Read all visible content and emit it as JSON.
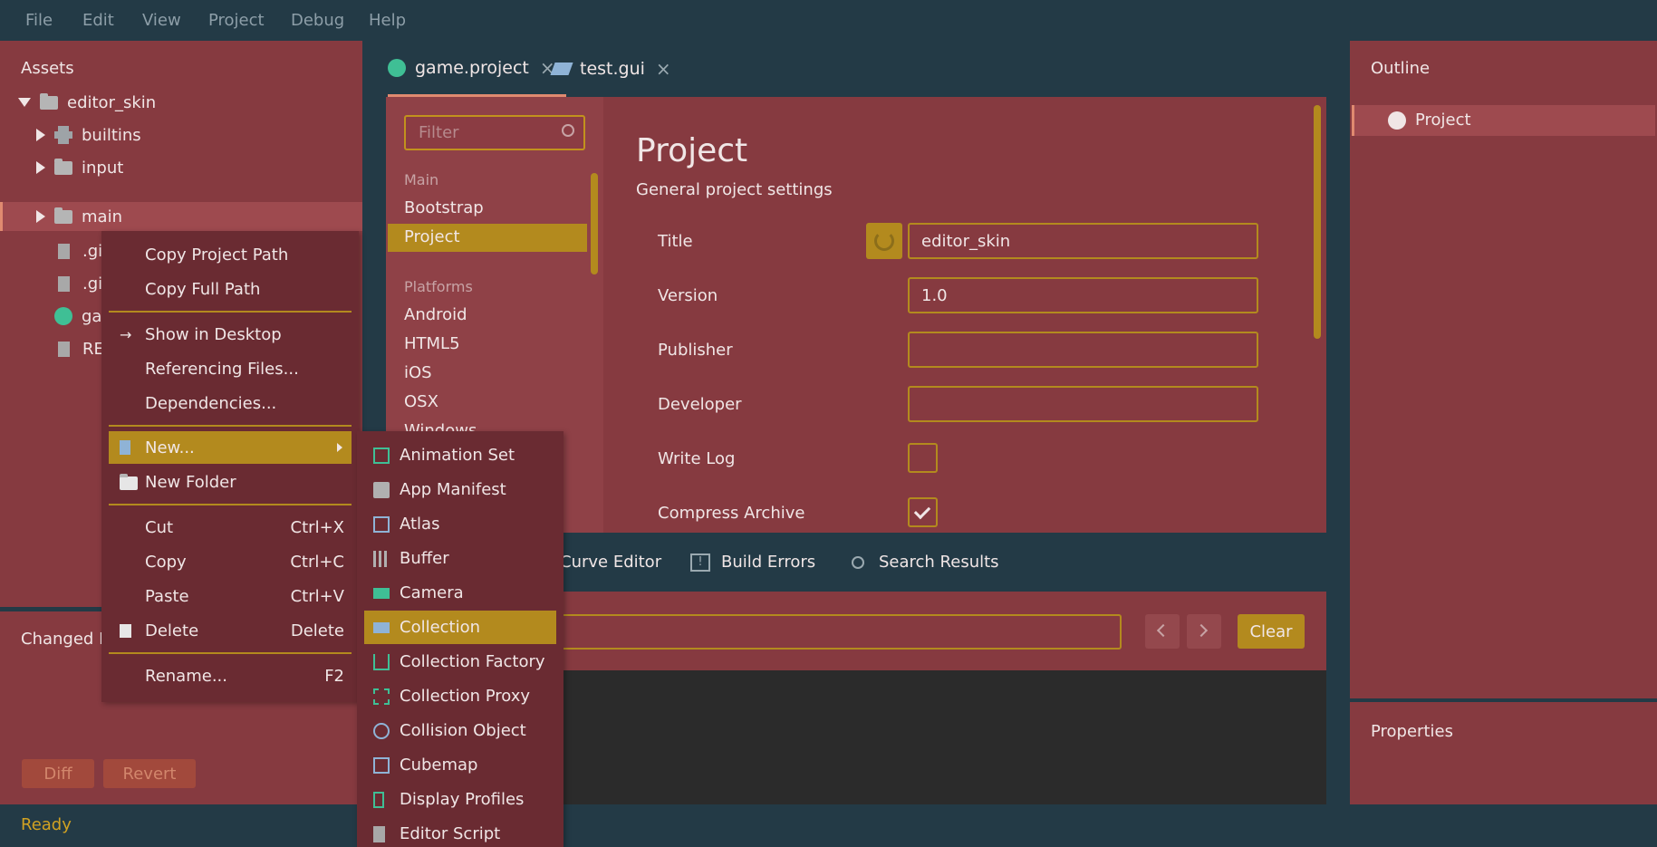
{
  "menubar": [
    "File",
    "Edit",
    "View",
    "Project",
    "Debug",
    "Help"
  ],
  "assets": {
    "title": "Assets",
    "tree": [
      {
        "label": "editor_skin",
        "icon": "folder-icon"
      },
      {
        "label": "builtins",
        "icon": "puzzle-icon"
      },
      {
        "label": "input",
        "icon": "folder-icon"
      },
      {
        "label": "main",
        "icon": "folder-icon"
      },
      {
        "label": ".gi",
        "icon": "file-icon"
      },
      {
        "label": ".gi",
        "icon": "file-icon"
      },
      {
        "label": "ga",
        "icon": "gear-icon"
      },
      {
        "label": "RE",
        "icon": "file-icon"
      }
    ]
  },
  "changed_files": {
    "title": "Changed Fi",
    "diff": "Diff",
    "revert": "Revert"
  },
  "tabs": [
    {
      "label": "game.project",
      "close": "×"
    },
    {
      "label": "test.gui",
      "close": "×"
    }
  ],
  "settings_nav": {
    "filter_placeholder": "Filter",
    "groups": [
      {
        "heading": "Main",
        "items": [
          "Bootstrap",
          "Project"
        ]
      },
      {
        "heading": "Platforms",
        "items": [
          "Android",
          "HTML5",
          "iOS",
          "OSX",
          "Windows"
        ]
      }
    ],
    "selected": "Project"
  },
  "project_form": {
    "title": "Project",
    "subtitle": "General project settings",
    "fields": [
      {
        "label": "Title",
        "value": "editor_skin"
      },
      {
        "label": "Version",
        "value": "1.0"
      },
      {
        "label": "Publisher",
        "value": ""
      },
      {
        "label": "Developer",
        "value": ""
      }
    ],
    "checks": [
      {
        "label": "Write Log",
        "checked": false
      },
      {
        "label": "Compress Archive",
        "checked": true
      }
    ]
  },
  "bottom_tabs": [
    "Curve Editor",
    "Build Errors",
    "Search Results"
  ],
  "console": {
    "clear": "Clear"
  },
  "outline": {
    "title": "Outline",
    "item": "Project"
  },
  "properties": {
    "title": "Properties"
  },
  "status": "Ready",
  "context_menu": {
    "items": [
      {
        "label": "Copy Project Path",
        "shortcut": ""
      },
      {
        "label": "Copy Full Path",
        "shortcut": ""
      },
      {
        "label": "Show in Desktop",
        "shortcut": ""
      },
      {
        "label": "Referencing Files...",
        "shortcut": ""
      },
      {
        "label": "Dependencies...",
        "shortcut": ""
      },
      {
        "label": "New...",
        "shortcut": ""
      },
      {
        "label": "New Folder",
        "shortcut": ""
      },
      {
        "label": "Cut",
        "shortcut": "Ctrl+X"
      },
      {
        "label": "Copy",
        "shortcut": "Ctrl+C"
      },
      {
        "label": "Paste",
        "shortcut": "Ctrl+V"
      },
      {
        "label": "Delete",
        "shortcut": "Delete"
      },
      {
        "label": "Rename...",
        "shortcut": "F2"
      }
    ]
  },
  "new_submenu": [
    "Animation Set",
    "App Manifest",
    "Atlas",
    "Buffer",
    "Camera",
    "Collection",
    "Collection Factory",
    "Collection Proxy",
    "Collision Object",
    "Cubemap",
    "Display Profiles",
    "Editor Script"
  ],
  "colors": {
    "accent": "#b38a1e",
    "panel": "#863a40",
    "background": "#233a46",
    "highlight": "#3fbf95"
  }
}
